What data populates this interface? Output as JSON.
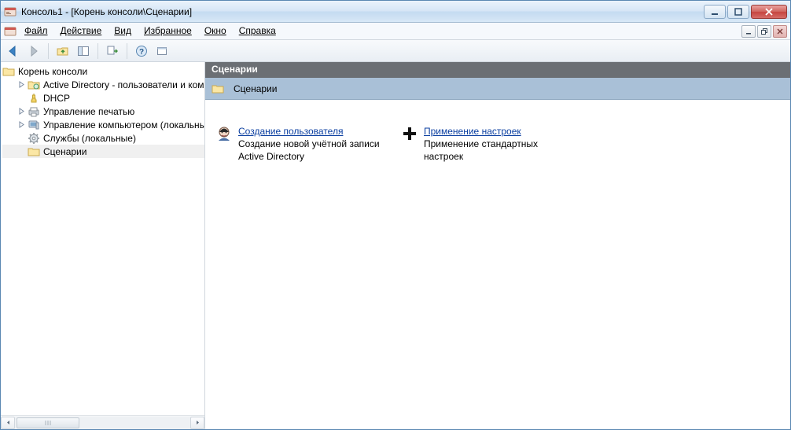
{
  "window": {
    "title": "Консоль1 - [Корень консоли\\Сценарии]"
  },
  "menu": {
    "file": "Файл",
    "action": "Действие",
    "view": "Вид",
    "favorites": "Избранное",
    "window": "Окно",
    "help": "Справка"
  },
  "tree": {
    "root": "Корень консоли",
    "items": [
      {
        "label": "Active Directory - пользователи и компьютеры",
        "icon": "ad",
        "expandable": true
      },
      {
        "label": "DHCP",
        "icon": "dhcp",
        "expandable": false
      },
      {
        "label": "Управление печатью",
        "icon": "print",
        "expandable": true
      },
      {
        "label": "Управление компьютером (локальным)",
        "icon": "comp",
        "expandable": true
      },
      {
        "label": "Службы (локальные)",
        "icon": "services",
        "expandable": false
      },
      {
        "label": "Сценарии",
        "icon": "folder",
        "expandable": false,
        "selected": true
      }
    ]
  },
  "pane": {
    "header": "Сценарии",
    "sub_label": "Сценарии"
  },
  "tasks": [
    {
      "title": "Создание пользователя",
      "desc": "Создание новой учётной записи Active Directory",
      "icon": "user-head"
    },
    {
      "title": "Применение настроек",
      "desc": "Применение стандартных настроек",
      "icon": "plus"
    }
  ]
}
